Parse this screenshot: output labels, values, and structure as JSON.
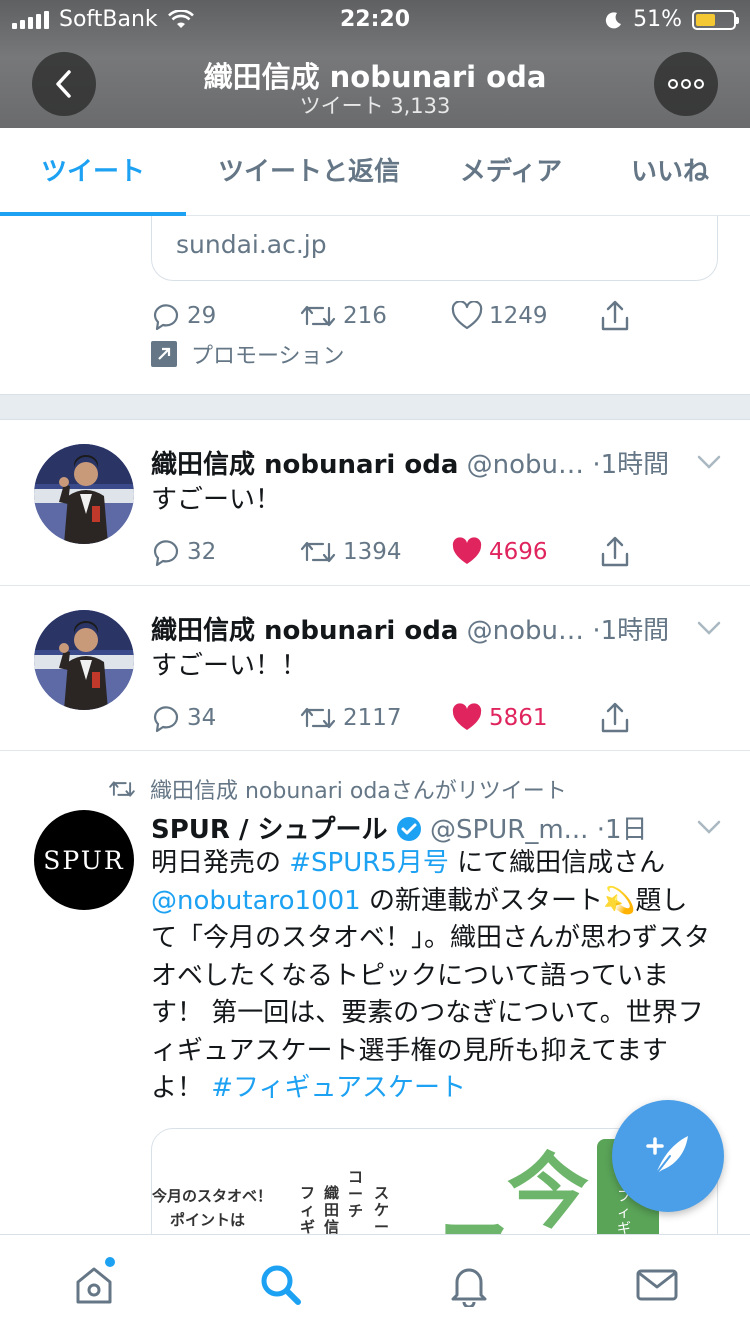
{
  "status_bar": {
    "carrier": "SoftBank",
    "time": "22:20",
    "battery": "51%",
    "battery_level": 0.51
  },
  "header": {
    "title": "織田信成 nobunari oda",
    "subtitle": "ツイート 3,133",
    "back_icon": "chevron-left-icon",
    "more_icon": "more-horizontal-icon"
  },
  "tabs": [
    {
      "label": "ツイート",
      "active": true
    },
    {
      "label": "ツイートと返信",
      "active": false
    },
    {
      "label": "メディア",
      "active": false
    },
    {
      "label": "いいね",
      "active": false
    }
  ],
  "promoted_tweet": {
    "link_domain": "sundai.ac.jp",
    "replies": "29",
    "retweets": "216",
    "likes": "1249",
    "promo_label": "プロモーション"
  },
  "tweets": [
    {
      "name": "織田信成 nobunari oda",
      "handle": "@nobu…",
      "time": "·1時間",
      "text": "すごーい！",
      "replies": "32",
      "retweets": "1394",
      "likes": "4696",
      "liked": true
    },
    {
      "name": "織田信成 nobunari oda",
      "handle": "@nobu…",
      "time": "·1時間",
      "text": "すごーい！！",
      "replies": "34",
      "retweets": "2117",
      "likes": "5861",
      "liked": true
    }
  ],
  "retweet": {
    "retweeted_by": "織田信成 nobunari odaさんがリツイート",
    "avatar_text": "SPUR",
    "name": "SPUR / シュプール",
    "handle": "@SPUR_m...",
    "time": "·1日",
    "text_part1": "明日発売の ",
    "hashtag1": "#SPUR5月号",
    "text_part2": " にて織田信成さん",
    "mention": "@nobutaro1001",
    "text_part3": " の新連載がスタート💫題して「今月のスタオベ！」。織田さんが思わずスタオベしたくなるトピックについて語っています！ 第一回は、要素のつなぎについて。世界フィギュアスケート選手権の見所も抑えてますよ！ ",
    "hashtag2": "#フィギュアスケート",
    "image_text": {
      "line1": "今月のスタオベ！",
      "line2": "ポイントは",
      "col1": "フィギ",
      "col2": "織田信",
      "col3": "コーチ",
      "col4": "スケー",
      "big": "今",
      "side": "フィギュア"
    }
  },
  "bottom_nav": [
    {
      "icon": "home-icon",
      "has_dot": true
    },
    {
      "icon": "search-icon",
      "active": true
    },
    {
      "icon": "bell-icon"
    },
    {
      "icon": "mail-icon"
    }
  ],
  "colors": {
    "accent": "#1da1f2",
    "like": "#e0245e",
    "muted": "#657786"
  }
}
